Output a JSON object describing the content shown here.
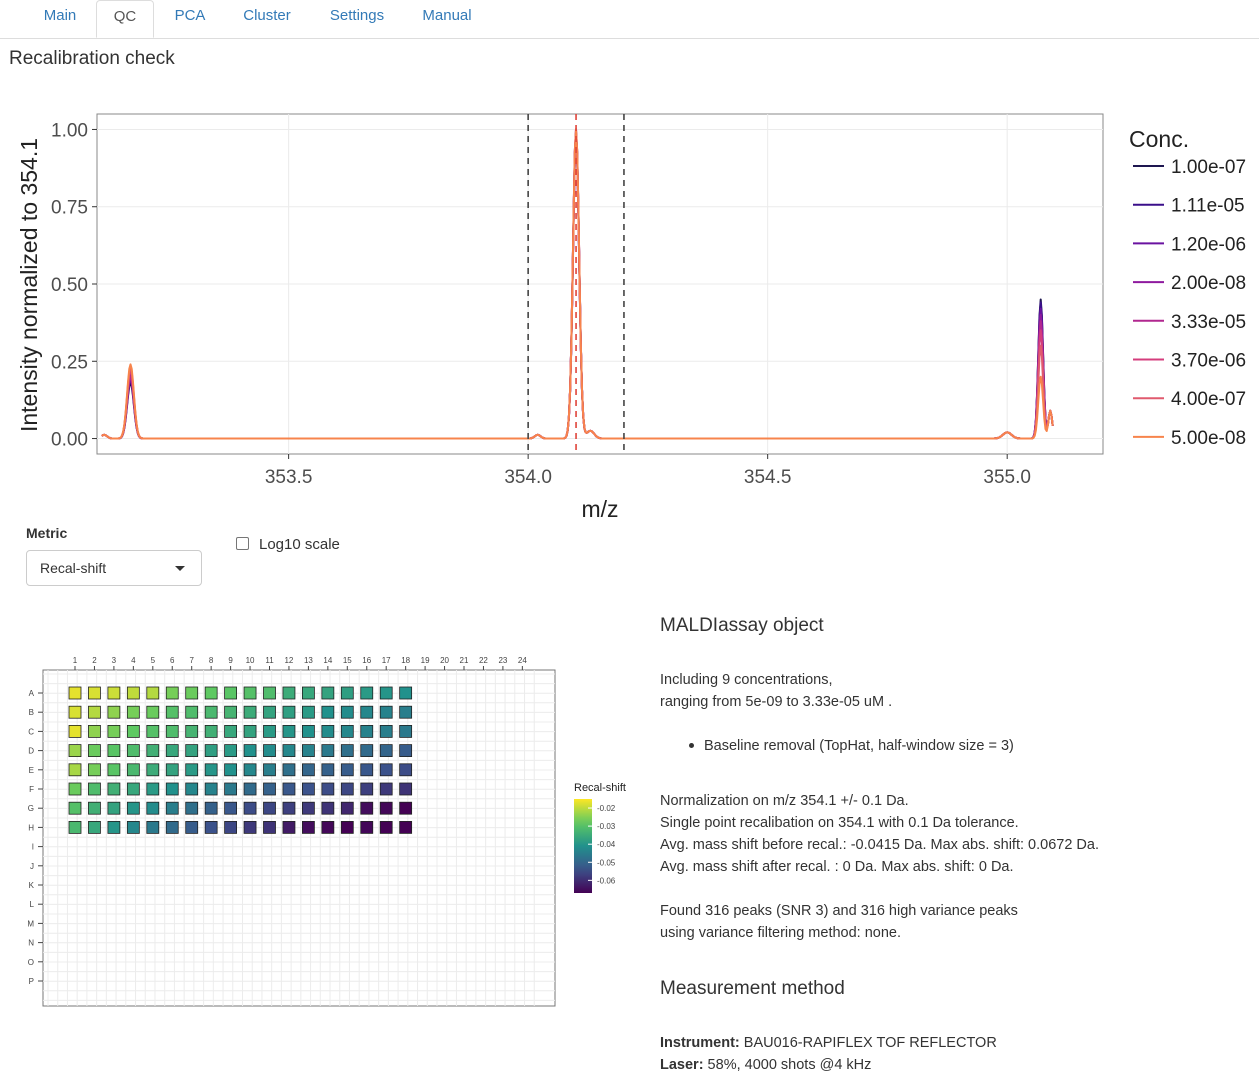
{
  "tabs": [
    "Main",
    "QC",
    "PCA",
    "Cluster",
    "Settings",
    "Manual"
  ],
  "active_tab": "QC",
  "section_title": "Recalibration check",
  "chart_data": [
    {
      "type": "line",
      "ylabel": "Intensity normalized to 354.1",
      "xlabel": "m/z",
      "xlim": [
        353.1,
        355.2
      ],
      "ylim": [
        -0.05,
        1.05
      ],
      "x_ticks": [
        "353.5",
        "354.0",
        "354.5",
        "355.0"
      ],
      "y_ticks": [
        "0.00",
        "0.25",
        "0.50",
        "0.75",
        "1.00"
      ],
      "vlines": [
        {
          "x": 354.0,
          "style": "dashed",
          "color": "#444444"
        },
        {
          "x": 354.1,
          "style": "dashed",
          "color": "#e0443a"
        },
        {
          "x": 354.2,
          "style": "dashed",
          "color": "#444444"
        }
      ],
      "legend_title": "Conc.",
      "legend_position": "right",
      "grid": true,
      "series": [
        {
          "name": "1.00e-07",
          "color": "#1e1650",
          "peaks": [
            [
              353.17,
              0.18
            ],
            [
              354.1,
              0.99
            ],
            [
              355.07,
              0.45
            ]
          ]
        },
        {
          "name": "1.11e-05",
          "color": "#3a0f8a",
          "peaks": [
            [
              353.17,
              0.2
            ],
            [
              354.1,
              0.98
            ],
            [
              355.07,
              0.44
            ]
          ]
        },
        {
          "name": "1.20e-06",
          "color": "#6a13a0",
          "peaks": [
            [
              353.17,
              0.19
            ],
            [
              354.1,
              0.99
            ],
            [
              355.07,
              0.42
            ]
          ]
        },
        {
          "name": "2.00e-08",
          "color": "#8e1a9e",
          "peaks": [
            [
              353.17,
              0.21
            ],
            [
              354.1,
              1.0
            ],
            [
              355.07,
              0.4
            ]
          ]
        },
        {
          "name": "3.33e-05",
          "color": "#b1278f",
          "peaks": [
            [
              353.17,
              0.2
            ],
            [
              354.1,
              0.97
            ],
            [
              355.07,
              0.38
            ]
          ]
        },
        {
          "name": "3.70e-06",
          "color": "#d43d7c",
          "peaks": [
            [
              353.17,
              0.22
            ],
            [
              354.1,
              1.0
            ],
            [
              355.07,
              0.35
            ]
          ]
        },
        {
          "name": "4.00e-07",
          "color": "#e05a6e",
          "peaks": [
            [
              353.17,
              0.23
            ],
            [
              354.1,
              0.99
            ],
            [
              355.07,
              0.3
            ]
          ]
        },
        {
          "name": "5.00e-08",
          "color": "#f7844c",
          "peaks": [
            [
              353.17,
              0.24
            ],
            [
              354.1,
              1.0
            ],
            [
              355.07,
              0.2
            ]
          ]
        }
      ]
    },
    {
      "type": "heatmap",
      "title": "Recal-shift",
      "columns": [
        "1",
        "2",
        "3",
        "4",
        "5",
        "6",
        "7",
        "8",
        "9",
        "10",
        "11",
        "12",
        "13",
        "14",
        "15",
        "16",
        "17",
        "18",
        "19",
        "20",
        "21",
        "22",
        "23",
        "24"
      ],
      "rows": [
        "A",
        "B",
        "C",
        "D",
        "E",
        "F",
        "G",
        "H",
        "I",
        "J",
        "K",
        "L",
        "M",
        "N",
        "O",
        "P"
      ],
      "colorbar_ticks": [
        "-0.02",
        "-0.03",
        "-0.04",
        "-0.05",
        "-0.06"
      ],
      "colorbar_range": [
        -0.067,
        -0.015
      ],
      "values": [
        [
          -0.017,
          -0.018,
          -0.019,
          -0.02,
          -0.021,
          -0.026,
          -0.027,
          -0.028,
          -0.029,
          -0.03,
          -0.031,
          -0.035,
          -0.036,
          -0.037,
          -0.038,
          -0.039,
          -0.04,
          -0.041
        ],
        [
          -0.018,
          -0.021,
          -0.024,
          -0.026,
          -0.027,
          -0.03,
          -0.031,
          -0.032,
          -0.033,
          -0.035,
          -0.037,
          -0.038,
          -0.039,
          -0.041,
          -0.042,
          -0.043,
          -0.044,
          -0.045
        ],
        [
          -0.017,
          -0.024,
          -0.026,
          -0.028,
          -0.03,
          -0.031,
          -0.033,
          -0.034,
          -0.036,
          -0.037,
          -0.039,
          -0.04,
          -0.041,
          -0.042,
          -0.043,
          -0.044,
          -0.045,
          -0.046
        ],
        [
          -0.023,
          -0.027,
          -0.029,
          -0.031,
          -0.034,
          -0.036,
          -0.037,
          -0.038,
          -0.039,
          -0.041,
          -0.042,
          -0.043,
          -0.044,
          -0.046,
          -0.048,
          -0.049,
          -0.05,
          -0.052
        ],
        [
          -0.022,
          -0.026,
          -0.029,
          -0.032,
          -0.035,
          -0.037,
          -0.039,
          -0.04,
          -0.041,
          -0.043,
          -0.045,
          -0.048,
          -0.05,
          -0.051,
          -0.052,
          -0.053,
          -0.054,
          -0.055
        ],
        [
          -0.027,
          -0.031,
          -0.034,
          -0.036,
          -0.039,
          -0.041,
          -0.043,
          -0.044,
          -0.046,
          -0.049,
          -0.051,
          -0.053,
          -0.054,
          -0.055,
          -0.056,
          -0.057,
          -0.058,
          -0.059
        ],
        [
          -0.03,
          -0.034,
          -0.037,
          -0.04,
          -0.042,
          -0.045,
          -0.048,
          -0.051,
          -0.053,
          -0.055,
          -0.056,
          -0.057,
          -0.058,
          -0.059,
          -0.061,
          -0.065,
          -0.066,
          -0.067
        ],
        [
          -0.032,
          -0.036,
          -0.04,
          -0.043,
          -0.046,
          -0.049,
          -0.052,
          -0.054,
          -0.056,
          -0.058,
          -0.059,
          -0.063,
          -0.065,
          -0.066,
          -0.067,
          -0.066,
          -0.067,
          -0.067
        ]
      ]
    }
  ],
  "controls": {
    "metric_label": "Metric",
    "metric_value": "Recal-shift",
    "log_label": "Log10 scale",
    "log_checked": false
  },
  "info": {
    "heading": "MALDIassay object",
    "line1": "Including 9 concentrations,",
    "line2": "ranging from 5e-09 to 3.33e-05 uM .",
    "bullet": "Baseline removal (TopHat, half-window size = 3)",
    "line3": "Normalization on m/z 354.1 +/- 0.1 Da.",
    "line4": "Single point recalibation on 354.1 with 0.1 Da tolerance.",
    "line5": "Avg. mass shift before recal.: -0.0415 Da. Max abs. shift: 0.0672 Da.",
    "line6": "Avg. mass shift after recal. : 0 Da. Max abs. shift: 0 Da.",
    "line7": "Found 316 peaks (SNR 3) and 316 high variance peaks",
    "line8": "using variance filtering method: none.",
    "heading2": "Measurement method",
    "instrument_label": "Instrument:",
    "instrument_value": " BAU016-RAPIFLEX TOF REFLECTOR",
    "laser_label": "Laser:",
    "laser_value": " 58%, 4000 shots @4 kHz"
  }
}
